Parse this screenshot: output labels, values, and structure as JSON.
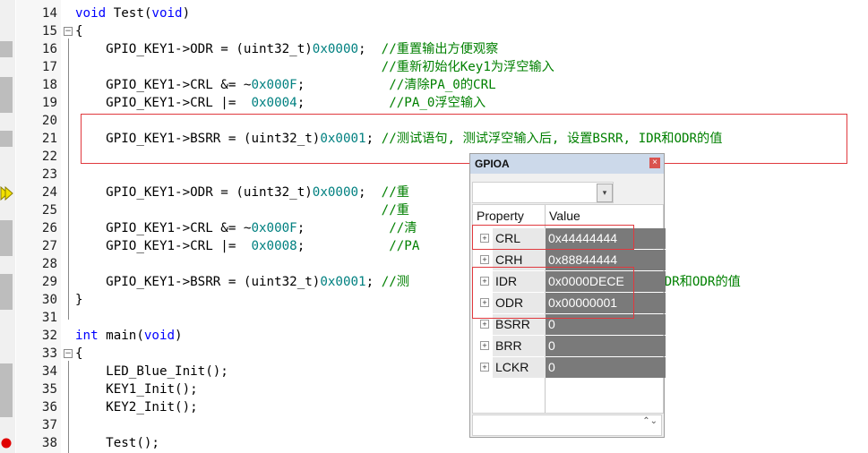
{
  "editor": {
    "lines": [
      {
        "n": "14",
        "code": [
          {
            "t": "void",
            "c": "kw"
          },
          {
            "t": " Test("
          },
          {
            "t": "void",
            "c": "kw"
          },
          {
            "t": ")"
          }
        ]
      },
      {
        "n": "15",
        "code": [
          {
            "t": "{"
          }
        ]
      },
      {
        "n": "16",
        "code": [
          {
            "t": "    GPIO_KEY1->ODR = (uint32_t)"
          },
          {
            "t": "0x0000",
            "c": "num"
          },
          {
            "t": ";  "
          },
          {
            "t": "//重置输出方便观察",
            "c": "cm"
          }
        ]
      },
      {
        "n": "17",
        "code": [
          {
            "t": "                                        "
          },
          {
            "t": "//重新初始化Key1为浮空输入",
            "c": "cm"
          }
        ]
      },
      {
        "n": "18",
        "code": [
          {
            "t": "    GPIO_KEY1->CRL &= ~"
          },
          {
            "t": "0x000F",
            "c": "num"
          },
          {
            "t": ";           "
          },
          {
            "t": "//清除PA_0的CRL",
            "c": "cm"
          }
        ]
      },
      {
        "n": "19",
        "code": [
          {
            "t": "    GPIO_KEY1->CRL |=  "
          },
          {
            "t": "0x0004",
            "c": "num"
          },
          {
            "t": ";           "
          },
          {
            "t": "//PA_0浮空输入",
            "c": "cm"
          }
        ]
      },
      {
        "n": "20",
        "code": []
      },
      {
        "n": "21",
        "code": [
          {
            "t": "    GPIO_KEY1->BSRR = (uint32_t)"
          },
          {
            "t": "0x0001",
            "c": "num"
          },
          {
            "t": "; "
          },
          {
            "t": "//测试语句, 测试浮空输入后, 设置BSRR, IDR和ODR的值",
            "c": "cm"
          }
        ]
      },
      {
        "n": "22",
        "code": []
      },
      {
        "n": "23",
        "code": []
      },
      {
        "n": "24",
        "code": [
          {
            "t": "    GPIO_KEY1->ODR = (uint32_t)"
          },
          {
            "t": "0x0000",
            "c": "num"
          },
          {
            "t": ";  "
          },
          {
            "t": "//重",
            "c": "cm"
          }
        ]
      },
      {
        "n": "25",
        "code": [
          {
            "t": "                                        "
          },
          {
            "t": "//重",
            "c": "cm"
          }
        ]
      },
      {
        "n": "26",
        "code": [
          {
            "t": "    GPIO_KEY1->CRL &= ~"
          },
          {
            "t": "0x000F",
            "c": "num"
          },
          {
            "t": ";           "
          },
          {
            "t": "//清",
            "c": "cm"
          }
        ]
      },
      {
        "n": "27",
        "code": [
          {
            "t": "    GPIO_KEY1->CRL |=  "
          },
          {
            "t": "0x0008",
            "c": "num"
          },
          {
            "t": ";           "
          },
          {
            "t": "//PA",
            "c": "cm"
          }
        ]
      },
      {
        "n": "28",
        "code": []
      },
      {
        "n": "29",
        "code": [
          {
            "t": "    GPIO_KEY1->BSRR = (uint32_t)"
          },
          {
            "t": "0x0001",
            "c": "num"
          },
          {
            "t": "; "
          },
          {
            "t": "//测                    ,  设置BSRR, IDR和ODR的值",
            "c": "cm"
          }
        ]
      },
      {
        "n": "30",
        "code": [
          {
            "t": "}"
          }
        ]
      },
      {
        "n": "31",
        "code": []
      },
      {
        "n": "32",
        "code": [
          {
            "t": "int",
            "c": "kw"
          },
          {
            "t": " main("
          },
          {
            "t": "void",
            "c": "kw"
          },
          {
            "t": ")"
          }
        ]
      },
      {
        "n": "33",
        "code": [
          {
            "t": "{"
          }
        ]
      },
      {
        "n": "34",
        "code": [
          {
            "t": "    LED_Blue_Init();"
          }
        ]
      },
      {
        "n": "35",
        "code": [
          {
            "t": "    KEY1_Init();"
          }
        ]
      },
      {
        "n": "36",
        "code": [
          {
            "t": "    KEY2_Init();"
          }
        ]
      },
      {
        "n": "37",
        "code": []
      },
      {
        "n": "38",
        "code": [
          {
            "t": "    Test();"
          }
        ]
      }
    ],
    "colors": {
      "keyword": "#0000ff",
      "number": "#008080",
      "comment": "#008000",
      "highlight_box": "#e0393e"
    }
  },
  "gpioa_window": {
    "title": "GPIOA",
    "close_glyph": "×",
    "combo_value": "",
    "combo_arrow": "▾",
    "header_property": "Property",
    "header_value": "Value",
    "spin_glyph": "⌃⌄",
    "rows": [
      {
        "name": "CRL",
        "value": "0x44444444",
        "expand": "+"
      },
      {
        "name": "CRH",
        "value": "0x88844444",
        "expand": "+"
      },
      {
        "name": "IDR",
        "value": "0x0000DECE",
        "expand": "+"
      },
      {
        "name": "ODR",
        "value": "0x00000001",
        "expand": "+"
      },
      {
        "name": "BSRR",
        "value": "0",
        "expand": "+"
      },
      {
        "name": "BRR",
        "value": "0",
        "expand": "+"
      },
      {
        "name": "LCKR",
        "value": "0",
        "expand": "+"
      }
    ]
  },
  "markers": {
    "current_line": "24",
    "breakpoint_line": "38",
    "current_line_color": "#f2e000",
    "breakpoint_color": "#e00000"
  }
}
